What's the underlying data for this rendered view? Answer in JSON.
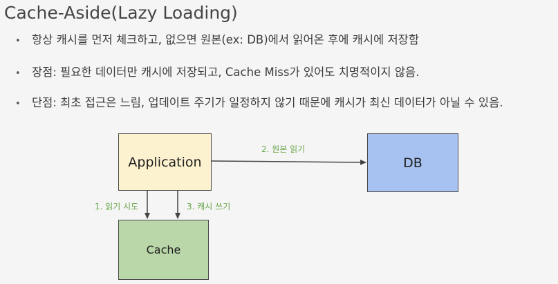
{
  "title": "Cache-Aside(Lazy Loading)",
  "bullets": [
    "항상 캐시를 먼저 체크하고, 없으면 원본(ex: DB)에서 읽어온 후에 캐시에 저장함",
    "장점: 필요한 데이터만 캐시에 저장되고, Cache Miss가 있어도 치명적이지 않음.",
    "단점: 최초 접근은 느림, 업데이트 주기가 일정하지 않기 때문에 캐시가 최신 데이터가 아닐 수 있음."
  ],
  "diagram": {
    "nodes": {
      "application": "Application",
      "db": "DB",
      "cache": "Cache"
    },
    "edges": {
      "app_to_db": "2. 원본 읽기",
      "app_to_cache_read": "1. 읽기 시도",
      "app_to_cache_write": "3. 캐시 쓰기"
    }
  },
  "colors": {
    "application_fill": "#fdf2cf",
    "db_fill": "#a7c2f0",
    "cache_fill": "#b9d7a9",
    "edge_label": "#6aa64a"
  }
}
